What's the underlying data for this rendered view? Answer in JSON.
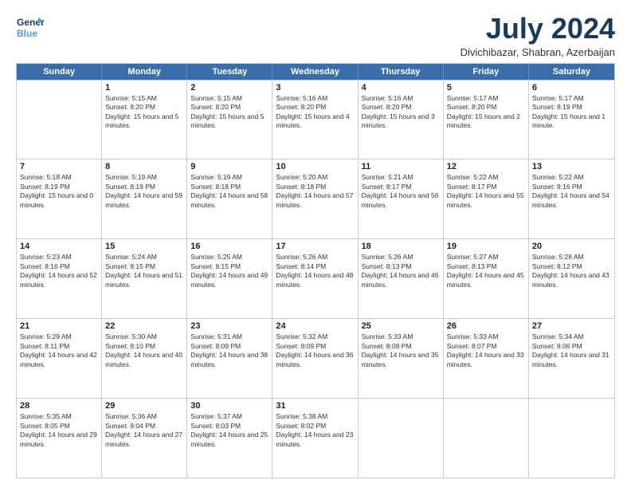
{
  "logo": {
    "line1": "General",
    "line2": "Blue",
    "icon_color": "#4a9fd4"
  },
  "header": {
    "month_year": "July 2024",
    "location": "Divichibazar, Shabran, Azerbaijan"
  },
  "weekdays": [
    "Sunday",
    "Monday",
    "Tuesday",
    "Wednesday",
    "Thursday",
    "Friday",
    "Saturday"
  ],
  "rows": [
    [
      {
        "day": "",
        "sunrise": "",
        "sunset": "",
        "daylight": ""
      },
      {
        "day": "1",
        "sunrise": "Sunrise: 5:15 AM",
        "sunset": "Sunset: 8:20 PM",
        "daylight": "Daylight: 15 hours and 5 minutes."
      },
      {
        "day": "2",
        "sunrise": "Sunrise: 5:15 AM",
        "sunset": "Sunset: 8:20 PM",
        "daylight": "Daylight: 15 hours and 5 minutes."
      },
      {
        "day": "3",
        "sunrise": "Sunrise: 5:16 AM",
        "sunset": "Sunset: 8:20 PM",
        "daylight": "Daylight: 15 hours and 4 minutes."
      },
      {
        "day": "4",
        "sunrise": "Sunrise: 5:16 AM",
        "sunset": "Sunset: 8:20 PM",
        "daylight": "Daylight: 15 hours and 3 minutes."
      },
      {
        "day": "5",
        "sunrise": "Sunrise: 5:17 AM",
        "sunset": "Sunset: 8:20 PM",
        "daylight": "Daylight: 15 hours and 2 minutes."
      },
      {
        "day": "6",
        "sunrise": "Sunrise: 5:17 AM",
        "sunset": "Sunset: 8:19 PM",
        "daylight": "Daylight: 15 hours and 1 minute."
      }
    ],
    [
      {
        "day": "7",
        "sunrise": "Sunrise: 5:18 AM",
        "sunset": "Sunset: 8:19 PM",
        "daylight": "Daylight: 15 hours and 0 minutes."
      },
      {
        "day": "8",
        "sunrise": "Sunrise: 5:19 AM",
        "sunset": "Sunset: 8:19 PM",
        "daylight": "Daylight: 14 hours and 59 minutes."
      },
      {
        "day": "9",
        "sunrise": "Sunrise: 5:19 AM",
        "sunset": "Sunset: 8:18 PM",
        "daylight": "Daylight: 14 hours and 58 minutes."
      },
      {
        "day": "10",
        "sunrise": "Sunrise: 5:20 AM",
        "sunset": "Sunset: 8:18 PM",
        "daylight": "Daylight: 14 hours and 57 minutes."
      },
      {
        "day": "11",
        "sunrise": "Sunrise: 5:21 AM",
        "sunset": "Sunset: 8:17 PM",
        "daylight": "Daylight: 14 hours and 56 minutes."
      },
      {
        "day": "12",
        "sunrise": "Sunrise: 5:22 AM",
        "sunset": "Sunset: 8:17 PM",
        "daylight": "Daylight: 14 hours and 55 minutes."
      },
      {
        "day": "13",
        "sunrise": "Sunrise: 5:22 AM",
        "sunset": "Sunset: 8:16 PM",
        "daylight": "Daylight: 14 hours and 54 minutes."
      }
    ],
    [
      {
        "day": "14",
        "sunrise": "Sunrise: 5:23 AM",
        "sunset": "Sunset: 8:16 PM",
        "daylight": "Daylight: 14 hours and 52 minutes."
      },
      {
        "day": "15",
        "sunrise": "Sunrise: 5:24 AM",
        "sunset": "Sunset: 8:15 PM",
        "daylight": "Daylight: 14 hours and 51 minutes."
      },
      {
        "day": "16",
        "sunrise": "Sunrise: 5:25 AM",
        "sunset": "Sunset: 8:15 PM",
        "daylight": "Daylight: 14 hours and 49 minutes."
      },
      {
        "day": "17",
        "sunrise": "Sunrise: 5:26 AM",
        "sunset": "Sunset: 8:14 PM",
        "daylight": "Daylight: 14 hours and 48 minutes."
      },
      {
        "day": "18",
        "sunrise": "Sunrise: 5:26 AM",
        "sunset": "Sunset: 8:13 PM",
        "daylight": "Daylight: 14 hours and 46 minutes."
      },
      {
        "day": "19",
        "sunrise": "Sunrise: 5:27 AM",
        "sunset": "Sunset: 8:13 PM",
        "daylight": "Daylight: 14 hours and 45 minutes."
      },
      {
        "day": "20",
        "sunrise": "Sunrise: 5:28 AM",
        "sunset": "Sunset: 8:12 PM",
        "daylight": "Daylight: 14 hours and 43 minutes."
      }
    ],
    [
      {
        "day": "21",
        "sunrise": "Sunrise: 5:29 AM",
        "sunset": "Sunset: 8:11 PM",
        "daylight": "Daylight: 14 hours and 42 minutes."
      },
      {
        "day": "22",
        "sunrise": "Sunrise: 5:30 AM",
        "sunset": "Sunset: 8:10 PM",
        "daylight": "Daylight: 14 hours and 40 minutes."
      },
      {
        "day": "23",
        "sunrise": "Sunrise: 5:31 AM",
        "sunset": "Sunset: 8:09 PM",
        "daylight": "Daylight: 14 hours and 38 minutes."
      },
      {
        "day": "24",
        "sunrise": "Sunrise: 5:32 AM",
        "sunset": "Sunset: 8:09 PM",
        "daylight": "Daylight: 14 hours and 36 minutes."
      },
      {
        "day": "25",
        "sunrise": "Sunrise: 5:33 AM",
        "sunset": "Sunset: 8:08 PM",
        "daylight": "Daylight: 14 hours and 35 minutes."
      },
      {
        "day": "26",
        "sunrise": "Sunrise: 5:33 AM",
        "sunset": "Sunset: 8:07 PM",
        "daylight": "Daylight: 14 hours and 33 minutes."
      },
      {
        "day": "27",
        "sunrise": "Sunrise: 5:34 AM",
        "sunset": "Sunset: 8:06 PM",
        "daylight": "Daylight: 14 hours and 31 minutes."
      }
    ],
    [
      {
        "day": "28",
        "sunrise": "Sunrise: 5:35 AM",
        "sunset": "Sunset: 8:05 PM",
        "daylight": "Daylight: 14 hours and 29 minutes."
      },
      {
        "day": "29",
        "sunrise": "Sunrise: 5:36 AM",
        "sunset": "Sunset: 8:04 PM",
        "daylight": "Daylight: 14 hours and 27 minutes."
      },
      {
        "day": "30",
        "sunrise": "Sunrise: 5:37 AM",
        "sunset": "Sunset: 8:03 PM",
        "daylight": "Daylight: 14 hours and 25 minutes."
      },
      {
        "day": "31",
        "sunrise": "Sunrise: 5:38 AM",
        "sunset": "Sunset: 8:02 PM",
        "daylight": "Daylight: 14 hours and 23 minutes."
      },
      {
        "day": "",
        "sunrise": "",
        "sunset": "",
        "daylight": ""
      },
      {
        "day": "",
        "sunrise": "",
        "sunset": "",
        "daylight": ""
      },
      {
        "day": "",
        "sunrise": "",
        "sunset": "",
        "daylight": ""
      }
    ]
  ]
}
